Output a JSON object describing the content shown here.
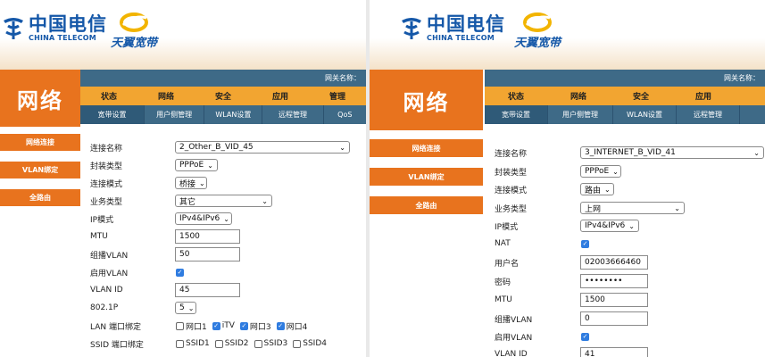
{
  "left": {
    "logo_cn": "中国电信",
    "logo_en": "CHINA TELECOM",
    "logo2": "天翼宽带",
    "topbar_text": "网关名称：",
    "brand": "网络",
    "side_items": [
      "网络连接",
      "VLAN绑定",
      "全路由"
    ],
    "nav1": [
      "状态",
      "网络",
      "安全",
      "应用",
      "管理"
    ],
    "nav2": [
      "宽带设置",
      "用户侧管理",
      "WLAN设置",
      "远程管理",
      "QoS"
    ],
    "form": {
      "conn_name_label": "连接名称",
      "conn_name_value": "2_Other_B_VID_45",
      "encap_label": "封装类型",
      "encap_value": "PPPoE",
      "mode_label": "连接模式",
      "mode_value": "桥接",
      "service_label": "业务类型",
      "service_value": "其它",
      "ipmode_label": "IP模式",
      "ipmode_value": "IPv4&IPv6",
      "mtu_label": "MTU",
      "mtu_value": "1500",
      "mcast_label": "组播VLAN",
      "mcast_value": "50",
      "vlan_enable_label": "启用VLAN",
      "vlanid_label": "VLAN ID",
      "vlanid_value": "45",
      "p8021_label": "802.1P",
      "p8021_value": "5",
      "lan_label": "LAN 端口绑定",
      "lan_ports": [
        {
          "label": "网口1",
          "checked": false
        },
        {
          "label": "iTV",
          "checked": true
        },
        {
          "label": "网口3",
          "checked": true
        },
        {
          "label": "网口4",
          "checked": true
        }
      ],
      "ssid_label": "SSID 端口绑定",
      "ssids": [
        "SSID1",
        "SSID2",
        "SSID3",
        "SSID4"
      ]
    }
  },
  "right": {
    "logo_cn": "中国电信",
    "logo_en": "CHINA TELECOM",
    "logo2": "天翼宽带",
    "topbar_text": "网关名称：",
    "brand": "网络",
    "side_items": [
      "网络连接",
      "VLAN绑定",
      "全路由"
    ],
    "nav1": [
      "状态",
      "网络",
      "安全",
      "应用"
    ],
    "nav2": [
      "宽带设置",
      "用户侧管理",
      "WLAN设置",
      "远程管理"
    ],
    "form": {
      "conn_name_label": "连接名称",
      "conn_name_value": "3_INTERNET_B_VID_41",
      "encap_label": "封装类型",
      "encap_value": "PPPoE",
      "mode_label": "连接模式",
      "mode_value": "路由",
      "service_label": "业务类型",
      "service_value": "上网",
      "ipmode_label": "IP模式",
      "ipmode_value": "IPv4&IPv6",
      "nat_label": "NAT",
      "user_label": "用户名",
      "user_value": "02003666460",
      "pwd_label": "密码",
      "pwd_value": "••••••••",
      "mtu_label": "MTU",
      "mtu_value": "1500",
      "mcast_label": "组播VLAN",
      "mcast_value": "0",
      "vlan_enable_label": "启用VLAN",
      "vlanid_label": "VLAN ID",
      "vlanid_value": "41"
    }
  },
  "colors": {
    "orange": "#e8731e",
    "nav_yellow": "#f2a531",
    "nav_blue": "#3e6a87",
    "check_blue": "#2f7ce0",
    "logo_blue": "#1457a8"
  },
  "icons": {
    "ct_logo": "china-telecom-logo-icon",
    "ty_logo": "tianyi-logo-icon",
    "checkbox": "checkmark-icon",
    "select": "chevron-down-icon"
  }
}
